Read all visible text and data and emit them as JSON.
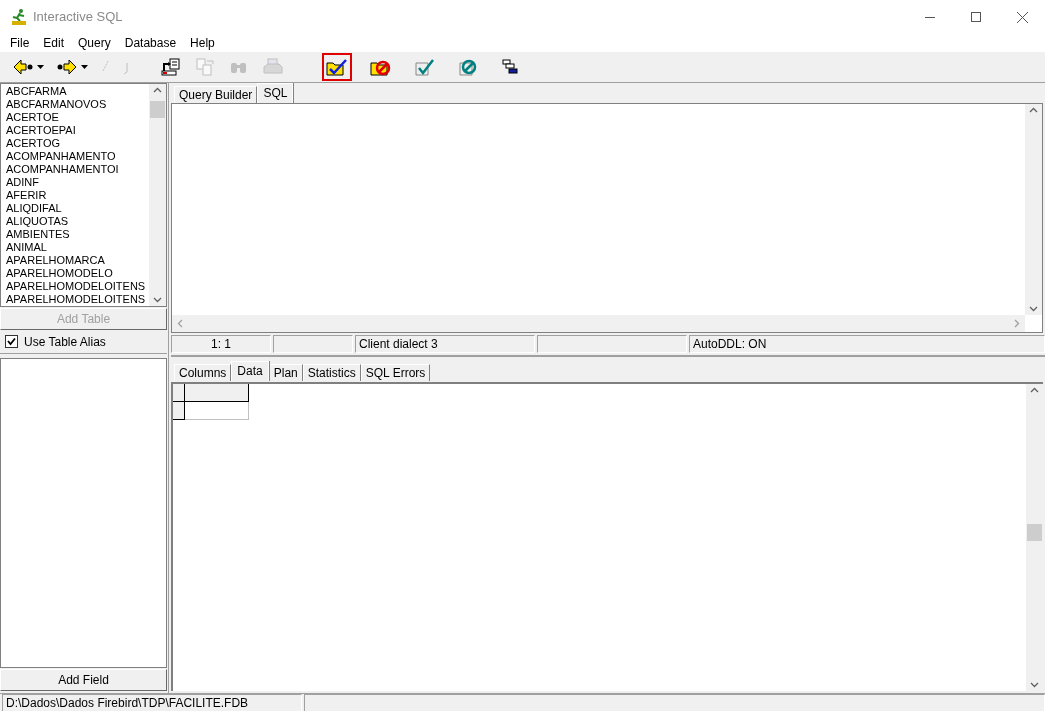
{
  "window": {
    "title": "Interactive SQL"
  },
  "menu": [
    "File",
    "Edit",
    "Query",
    "Database",
    "Help"
  ],
  "toolbar": [
    {
      "disabled": false,
      "highlighted": false
    },
    {
      "disabled": false,
      "highlighted": false
    },
    {
      "disabled": true,
      "highlighted": false
    },
    {
      "disabled": true,
      "highlighted": false
    },
    {
      "disabled": false,
      "highlighted": false
    },
    {
      "disabled": true,
      "highlighted": false
    },
    {
      "disabled": true,
      "highlighted": false
    },
    {
      "disabled": true,
      "highlighted": false
    },
    {
      "disabled": false,
      "highlighted": true
    },
    {
      "disabled": false,
      "highlighted": false
    },
    {
      "disabled": false,
      "highlighted": false
    },
    {
      "disabled": false,
      "highlighted": false
    },
    {
      "disabled": false,
      "highlighted": false
    }
  ],
  "tables": [
    "ABCFARMA",
    "ABCFARMANOVOS",
    "ACERTOE",
    "ACERTOEPAI",
    "ACERTOG",
    "ACOMPANHAMENTO",
    "ACOMPANHAMENTOI",
    "ADINF",
    "AFERIR",
    "ALIQDIFAL",
    "ALIQUOTAS",
    "AMBIENTES",
    "ANIMAL",
    "APARELHOMARCA",
    "APARELHOMODELO",
    "APARELHOMODELOITENS",
    "APARELHOMODELOITENS"
  ],
  "add_table_button": {
    "label": "Add Table",
    "disabled": true
  },
  "use_table_alias": {
    "label": "Use Table Alias",
    "checked": true
  },
  "add_field_button": {
    "label": "Add Field",
    "disabled": false
  },
  "editor_tabs": [
    {
      "label": "Query Builder",
      "selected": false
    },
    {
      "label": "SQL",
      "selected": true
    }
  ],
  "editor_status": [
    {
      "kind": "text",
      "text": "1: 1"
    },
    {
      "kind": "blank"
    },
    {
      "kind": "text",
      "text": "Client dialect 3"
    },
    {
      "kind": "blank"
    },
    {
      "kind": "text",
      "text": "AutoDDL: ON"
    }
  ],
  "result_tabs": [
    {
      "label": "Columns",
      "selected": false
    },
    {
      "label": "Data",
      "selected": true
    },
    {
      "label": "Plan",
      "selected": false
    },
    {
      "label": "Statistics",
      "selected": false
    },
    {
      "label": "SQL Errors",
      "selected": false
    }
  ],
  "status_bar": [
    {
      "kind": "text",
      "text": "D:\\Dados\\Dados Firebird\\TDP\\FACILITE.FDB"
    },
    {
      "kind": "blank"
    }
  ]
}
